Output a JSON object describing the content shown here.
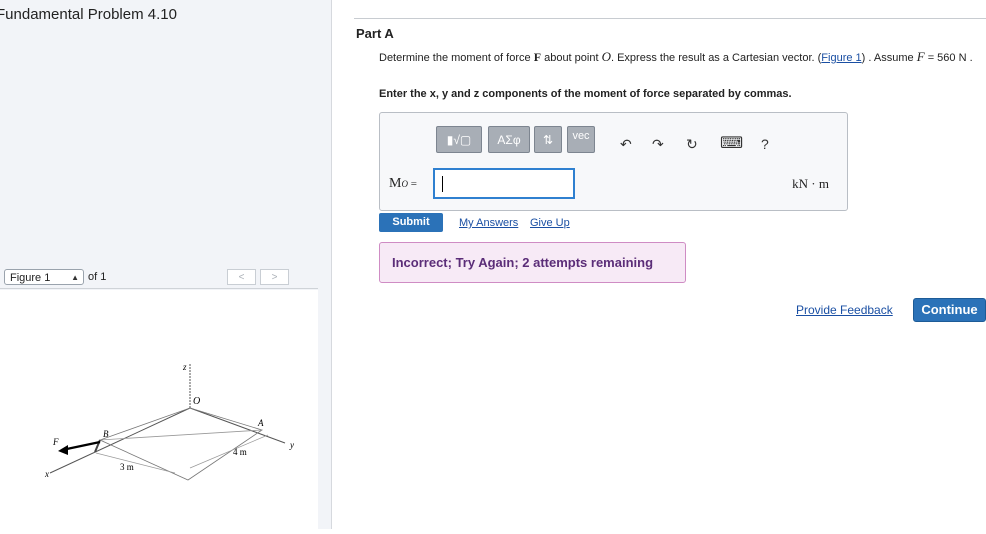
{
  "title": "Fundamental Problem 4.10",
  "figure_nav": {
    "selected": "Figure 1",
    "of_label": "of 1",
    "prev": "<",
    "next": ">"
  },
  "figure": {
    "labels": [
      "z",
      "O",
      "F",
      "B",
      "A",
      "y",
      "4 m",
      "3 m",
      "x"
    ]
  },
  "part": {
    "label": "Part A",
    "question_pre": "Determine the moment of force ",
    "question_force_symbol": "F",
    "question_mid": " about point ",
    "question_point": "O",
    "question_after": ". Express the result as a Cartesian vector. (",
    "figure_link": "Figure 1",
    "question_assume": ") . Assume ",
    "assume_var": "F",
    "assume_eq": " = 560 N .",
    "instruction": "Enter the x, y and z components of the moment of force separated by commas."
  },
  "toolbar": {
    "templates": "▮√▢",
    "greek": "ΑΣφ",
    "arrows": "⇅",
    "vec": "vec",
    "undo": "↶",
    "redo": "↷",
    "reset": "↻",
    "keyboard": "⌨",
    "help": "?"
  },
  "answer": {
    "label_main": "M",
    "label_sub": "O",
    "label_eq": " =",
    "value": "",
    "units": "kN · m"
  },
  "actions": {
    "submit": "Submit",
    "my_answers": "My Answers",
    "give_up": "Give Up",
    "feedback_message": "Incorrect; Try Again; 2 attempts remaining",
    "provide_feedback": "Provide Feedback",
    "continue": "Continue"
  },
  "colors": {
    "accent": "#2b72b8",
    "incorrect_bg": "#f7eaf6",
    "incorrect_border": "#cf8cc4",
    "incorrect_text": "#5b2d78",
    "link": "#1a4fa3"
  }
}
